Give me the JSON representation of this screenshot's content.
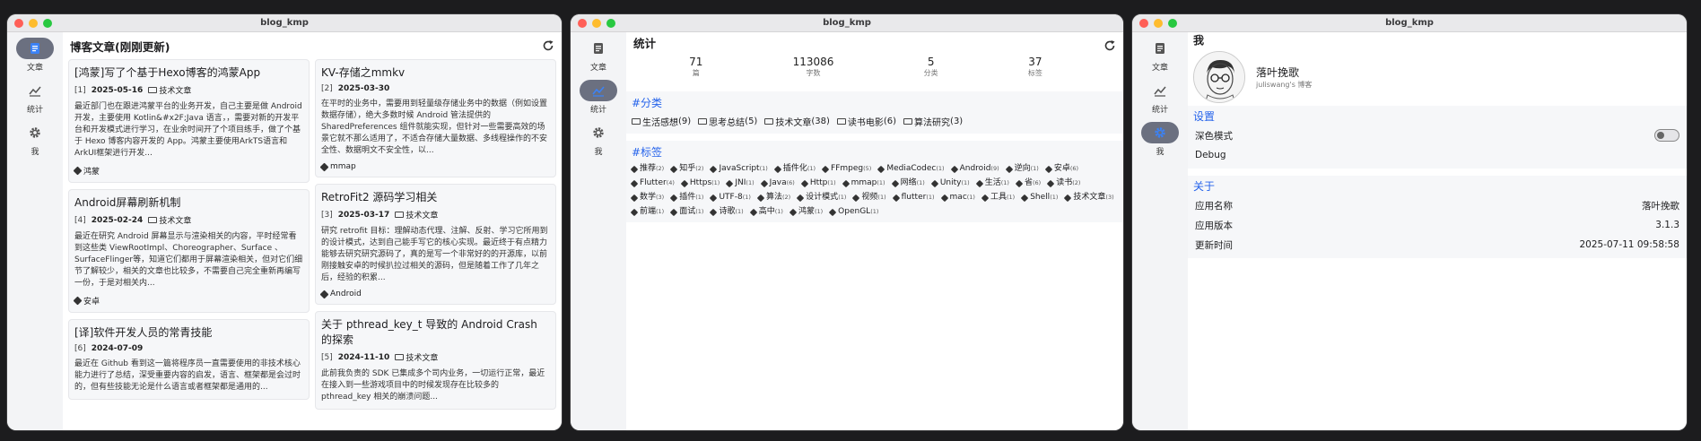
{
  "window_title": "blog_kmp",
  "nav": [
    {
      "label": "文章",
      "icon": "document-icon"
    },
    {
      "label": "统计",
      "icon": "chart-icon"
    },
    {
      "label": "我",
      "icon": "gear-icon"
    }
  ],
  "articles": {
    "header": "博客文章(刚刚更新)",
    "left": [
      {
        "title": "[鸿蒙]写了个基于Hexo博客的鸿蒙App",
        "idx": "[1]",
        "date": "2025-05-16",
        "category": "技术文章",
        "excerpt": "最近部门也在跟进鸿蒙平台的业务开发，自己主要是做 Android 开发，主要使用 Kotlin&#x2F;Java 语言，，需要对新的开发平台和开发模式进行学习，在业余时间开了个项目练手，做了个基于 Hexo 博客内容开发的 App。鸿蒙主要使用ArkTS语言和ArkUI框架进行开发...",
        "tag": "鸿蒙"
      },
      {
        "title": "Android屏幕刷新机制",
        "idx": "[4]",
        "date": "2025-02-24",
        "category": "技术文章",
        "excerpt": "最近在研究 Android 屏幕显示与渲染相关的内容，平时经常看到这些类 ViewRootImpl、Choreographer、Surface 、SurfaceFlinger等，知道它们都用于屏幕渲染相关，但对它们细节了解较少，相关的文章也比较多，不需要自己完全重新再编写一份，于是对相关内...",
        "tag": "安卓"
      },
      {
        "title": "[译]软件开发人员的常青技能",
        "idx": "[6]",
        "date": "2024-07-09",
        "category": "",
        "excerpt": "最近在 Github 看到这一篇将程序员一直需要使用的非技术核心能力进行了总结，深受重要内容的启发，语言、框架都是会过时的，但有些技能无论是什么语言或者框架都是通用的...",
        "tag": ""
      }
    ],
    "right": [
      {
        "title": "KV-存储之mmkv",
        "idx": "[2]",
        "date": "2025-03-30",
        "category": "",
        "excerpt": "在平时的业务中，需要用到轻量级存储业务中的数据（例如设置数据存储），绝大多数时候 Android 管法提供的 SharedPreferences 组件就能实现，但针对一些需要高效的场景它就不那么适用了，不适合存储大量数据、多线程操作的不安全性、数据明文不安全性，以...",
        "tag": "mmap"
      },
      {
        "title": "RetroFit2 源码学习相关",
        "idx": "[3]",
        "date": "2025-03-17",
        "category": "技术文章",
        "excerpt": "研究 retrofit 目标：理解动态代理、注解、反射、学习它所用到的设计模式，达到自己能手写它的核心实现。最近终于有点精力能够去研究研究源码了，真的是写一个非常好的的开源库，以前刚接触安卓的时候扒拉过相关的源码，但是随着工作了几年之后，经验的积累...",
        "tag": "Android"
      },
      {
        "title": "关于 pthread_key_t 导致的 Android Crash 的探索",
        "idx": "[5]",
        "date": "2024-11-10",
        "category": "技术文章",
        "excerpt": "此前我负责的 SDK 已集成多个司内业务，一切运行正常，最近在接入到一些游戏项目中的时候发现存在比较多的 pthread_key 相关的崩溃问题...",
        "tag": ""
      }
    ]
  },
  "stats": {
    "header": "统计",
    "summary": [
      {
        "value": "71",
        "label": "篇"
      },
      {
        "value": "113086",
        "label": "字数"
      },
      {
        "value": "5",
        "label": "分类"
      },
      {
        "value": "37",
        "label": "标签"
      }
    ],
    "categories_title": "#分类",
    "categories": [
      {
        "name": "生活感想",
        "count": "(9)"
      },
      {
        "name": "思考总结",
        "count": "(5)"
      },
      {
        "name": "技术文章",
        "count": "(38)"
      },
      {
        "name": "读书电影",
        "count": "(6)"
      },
      {
        "name": "算法研究",
        "count": "(3)"
      }
    ],
    "tags_title": "#标签",
    "tags": [
      {
        "name": "推荐",
        "count": "(2)"
      },
      {
        "name": "知乎",
        "count": "(2)"
      },
      {
        "name": "JavaScript",
        "count": "(1)"
      },
      {
        "name": "插件化",
        "count": "(1)"
      },
      {
        "name": "FFmpeg",
        "count": "(5)"
      },
      {
        "name": "MediaCodec",
        "count": "(1)"
      },
      {
        "name": "Android",
        "count": "(9)"
      },
      {
        "name": "逆向",
        "count": "(1)"
      },
      {
        "name": "安卓",
        "count": "(6)"
      },
      {
        "name": "Flutter",
        "count": "(4)"
      },
      {
        "name": "Https",
        "count": "(1)"
      },
      {
        "name": "JNI",
        "count": "(1)"
      },
      {
        "name": "Java",
        "count": "(6)"
      },
      {
        "name": "Http",
        "count": "(1)"
      },
      {
        "name": "mmap",
        "count": "(1)"
      },
      {
        "name": "网络",
        "count": "(1)"
      },
      {
        "name": "Unity",
        "count": "(1)"
      },
      {
        "name": "生活",
        "count": "(1)"
      },
      {
        "name": "省",
        "count": "(6)"
      },
      {
        "name": "读书",
        "count": "(2)"
      },
      {
        "name": "数学",
        "count": "(3)"
      },
      {
        "name": "插件",
        "count": "(1)"
      },
      {
        "name": "UTF-8",
        "count": "(1)"
      },
      {
        "name": "算法",
        "count": "(2)"
      },
      {
        "name": "设计模式",
        "count": "(1)"
      },
      {
        "name": "视频",
        "count": "(1)"
      },
      {
        "name": "flutter",
        "count": "(1)"
      },
      {
        "name": "mac",
        "count": "(1)"
      },
      {
        "name": "工具",
        "count": "(1)"
      },
      {
        "name": "Shell",
        "count": "(1)"
      },
      {
        "name": "技术文章",
        "count": "(3)"
      },
      {
        "name": "前端",
        "count": "(1)"
      },
      {
        "name": "面试",
        "count": "(1)"
      },
      {
        "name": "诗歌",
        "count": "(1)"
      },
      {
        "name": "高中",
        "count": "(1)"
      },
      {
        "name": "鸿蒙",
        "count": "(1)"
      },
      {
        "name": "OpenGL",
        "count": "(1)"
      }
    ]
  },
  "me": {
    "header": "我",
    "name": "落叶挽歌",
    "subtitle": "juliswang's 博客",
    "settings_title": "设置",
    "dark_mode": "深色模式",
    "debug": "Debug",
    "about_title": "关于",
    "app_name_label": "应用名称",
    "app_name": "落叶挽歌",
    "app_version_label": "应用版本",
    "app_version": "3.1.3",
    "update_label": "更新时间",
    "update_time": "2025-07-11 09:58:58"
  },
  "colors": {
    "accent": "#2563eb",
    "active_pill": "#6b7080"
  }
}
